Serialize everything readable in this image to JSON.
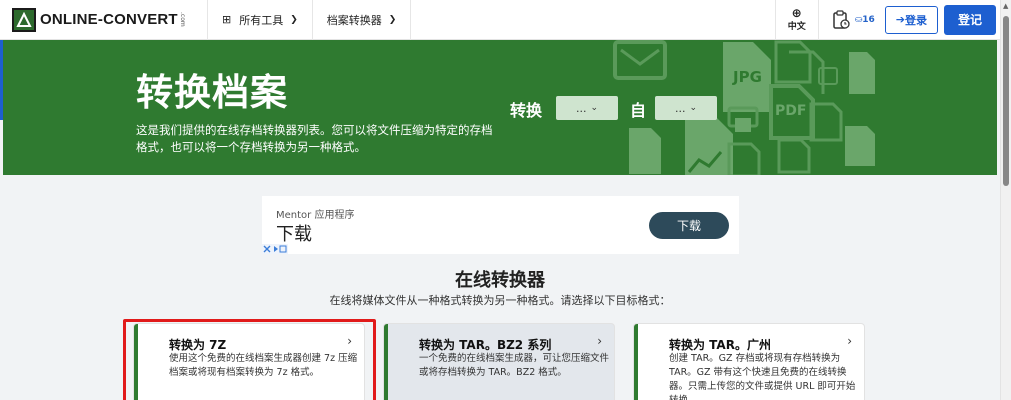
{
  "nav": {
    "logo_text": "ONLINE-CONVERT",
    "logo_suffix": ".com",
    "all_tools": "所有工具",
    "archive_converter": "档案转换器",
    "language": "中文",
    "credits": "16",
    "login": "登录",
    "signup": "登记"
  },
  "hero": {
    "title": "转换档案",
    "description": "这是我们提供的在线存档转换器列表。您可以将文件压缩为特定的存档格式，也可以将一个存档转换为另一种格式。",
    "convert_label": "转换",
    "from_label": "自",
    "select_to": "...",
    "select_from": "..."
  },
  "ad": {
    "small_text": "Mentor 应用程序",
    "big_text": "下载",
    "button": "下载"
  },
  "section": {
    "title": "在线转换器",
    "subtitle": "在线将媒体文件从一种格式转换为另一种格式。请选择以下目标格式："
  },
  "cards": [
    {
      "title": "转换为 7Z",
      "desc": "使用这个免费的在线档案生成器创建 7z 压缩档案或将现有档案转换为 7z 格式。"
    },
    {
      "title": "转换为 TAR。BZ2 系列",
      "desc": "一个免费的在线档案生成器，可让您压缩文件或将存档转换为 TAR。BZ2 格式。"
    },
    {
      "title": "转换为 TAR。广州",
      "desc": "创建 TAR。GZ 存档或将现有存档转换为 TAR。GZ 带有这个快速且免费的在线转换器。只需上传您的文件或提供 URL 即可开始转换。"
    }
  ],
  "colors": {
    "green": "#2f7a30",
    "blue": "#1d5fd0",
    "highlight": "#e11a1a"
  }
}
